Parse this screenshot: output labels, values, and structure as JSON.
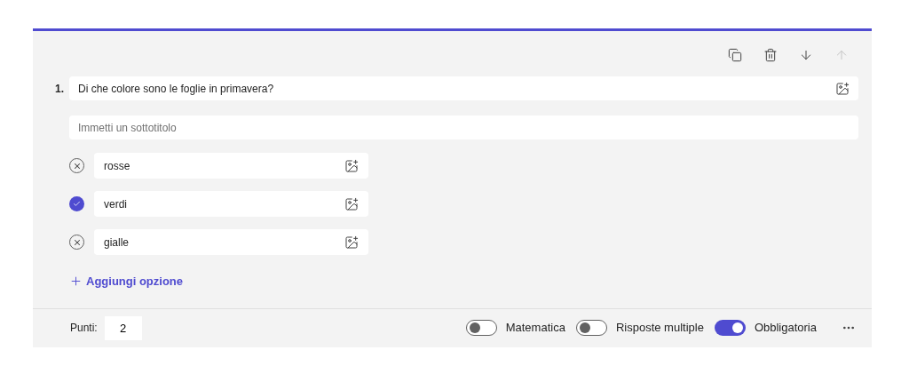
{
  "toolbar": [
    {
      "kind": "copy",
      "disabled": false
    },
    {
      "kind": "delete",
      "disabled": false
    },
    {
      "kind": "down",
      "disabled": false
    },
    {
      "kind": "up",
      "disabled": true
    }
  ],
  "question": {
    "number": "1.",
    "text": "Di che colore sono le foglie in primavera?"
  },
  "subtitle": {
    "placeholder": "Immetti un sottotitolo"
  },
  "options": [
    {
      "text": "rosse",
      "selected": false
    },
    {
      "text": "verdi",
      "selected": true
    },
    {
      "text": "gialle",
      "selected": false
    }
  ],
  "add_option": "Aggiungi opzione",
  "points": {
    "label": "Punti:",
    "value": "2"
  },
  "toggles": [
    {
      "label": "Matematica",
      "on": false
    },
    {
      "label": "Risposte multiple",
      "on": false
    },
    {
      "label": "Obbligatoria",
      "on": true
    }
  ]
}
